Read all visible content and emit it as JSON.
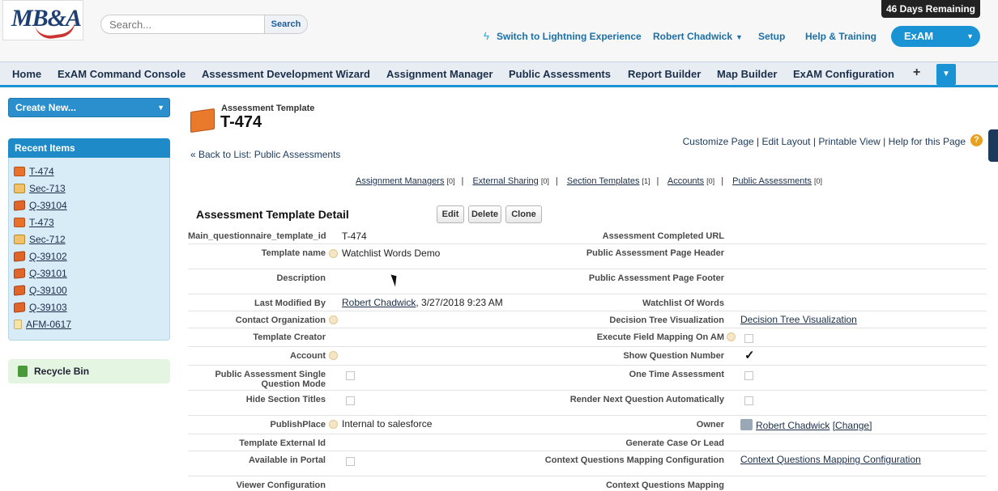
{
  "header": {
    "logo_text": "MB&A",
    "search_placeholder": "Search...",
    "search_button": "Search",
    "days_remaining": "46 Days Remaining",
    "switch_lightning": "Switch to Lightning Experience",
    "user_name": "Robert Chadwick",
    "setup": "Setup",
    "help_training": "Help & Training",
    "app_name": "ExAM"
  },
  "tabs": [
    {
      "label": "Home"
    },
    {
      "label": "ExAM Command Console"
    },
    {
      "label": "Assessment Development Wizard"
    },
    {
      "label": "Assignment Manager"
    },
    {
      "label": "Public Assessments"
    },
    {
      "label": "Report Builder"
    },
    {
      "label": "Map Builder"
    },
    {
      "label": "ExAM Configuration"
    }
  ],
  "sidebar": {
    "create_new": "Create New...",
    "recent_title": "Recent Items",
    "recent_items": [
      {
        "label": "T-474",
        "icon": "template-icon"
      },
      {
        "label": "Sec-713",
        "icon": "section-icon"
      },
      {
        "label": "Q-39104",
        "icon": "question-icon"
      },
      {
        "label": "T-473",
        "icon": "template-icon"
      },
      {
        "label": "Sec-712",
        "icon": "section-icon"
      },
      {
        "label": "Q-39102",
        "icon": "question-icon"
      },
      {
        "label": "Q-39101",
        "icon": "question-icon"
      },
      {
        "label": "Q-39100",
        "icon": "question-icon"
      },
      {
        "label": "Q-39103",
        "icon": "question-icon"
      },
      {
        "label": "AFM-0617",
        "icon": "mapping-icon"
      }
    ],
    "recycle_bin": "Recycle Bin"
  },
  "record": {
    "type": "Assessment Template",
    "title": "T-474",
    "page_links": [
      "Customize Page",
      "Edit Layout",
      "Printable View",
      "Help for this Page"
    ],
    "back_link": "« Back to List: Public Assessments",
    "related": [
      {
        "label": "Assignment Managers",
        "count": "[0]"
      },
      {
        "label": "External Sharing",
        "count": "[0]"
      },
      {
        "label": "Section Templates",
        "count": "[1]"
      },
      {
        "label": "Accounts",
        "count": "[0]"
      },
      {
        "label": "Public Assessments",
        "count": "[0]"
      }
    ],
    "detail_title": "Assessment Template Detail",
    "buttons": {
      "edit": "Edit",
      "delete": "Delete",
      "clone": "Clone"
    },
    "fields": {
      "main_id_label": "Main_questionnaire_template_id",
      "main_id_value": "T-474",
      "completed_url_label": "Assessment Completed URL",
      "template_name_label": "Template name",
      "template_name_value": "Watchlist Words Demo",
      "page_header_label": "Public Assessment Page Header",
      "description_label": "Description",
      "page_footer_label": "Public Assessment Page Footer",
      "last_modified_label": "Last Modified By",
      "last_modified_user": "Robert Chadwick",
      "last_modified_date": ", 3/27/2018 9:23 AM",
      "watchlist_label": "Watchlist Of Words",
      "contact_org_label": "Contact Organization",
      "decision_tree_label": "Decision Tree Visualization",
      "decision_tree_value": "Decision Tree Visualization",
      "creator_label": "Template Creator",
      "exec_mapping_label": "Execute Field Mapping On AM",
      "account_label": "Account",
      "show_qnum_label": "Show Question Number",
      "single_q_label": "Public Assessment Single Question Mode",
      "one_time_label": "One Time Assessment",
      "hide_titles_label": "Hide Section Titles",
      "render_next_label": "Render Next Question Automatically",
      "publish_label": "PublishPlace",
      "publish_value": "Internal to salesforce",
      "owner_label": "Owner",
      "owner_value": "Robert Chadwick",
      "owner_change": "[Change]",
      "external_id_label": "Template External Id",
      "generate_case_label": "Generate Case Or Lead",
      "available_portal_label": "Available in Portal",
      "context_config_label": "Context Questions Mapping Configuration",
      "context_config_value": "Context Questions Mapping Configuration",
      "viewer_config_label": "Viewer Configuration",
      "context_mapping_label": "Context Questions Mapping"
    }
  },
  "colors": {
    "accent": "#1a93d4",
    "sidebar_bg": "#d8ecf7",
    "recycle_bg": "#e4f5e1"
  }
}
